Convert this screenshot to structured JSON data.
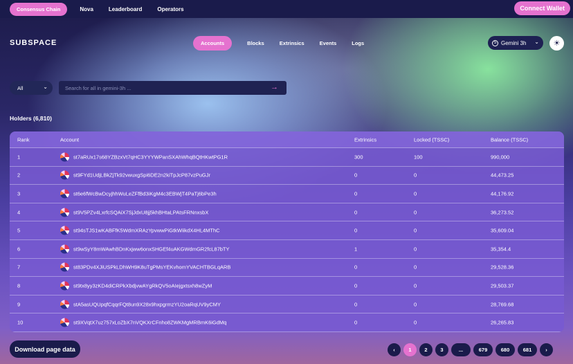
{
  "topbar": {
    "chain_label": "Consensus Chain",
    "links": [
      "Nova",
      "Leaderboard",
      "Operators"
    ],
    "connect_label": "Connect Wallet"
  },
  "logo": "SUBSPACE",
  "main_nav": {
    "tabs": [
      "Accounts",
      "Blocks",
      "Extrinsics",
      "Events",
      "Logs"
    ],
    "active": "Accounts"
  },
  "network": {
    "label": "Gemini 3h"
  },
  "search": {
    "filter_value": "All",
    "placeholder": "Search for all in gemini-3h ..."
  },
  "holders_title": "Holders (6,810)",
  "table": {
    "headers": [
      "Rank",
      "Account",
      "Extrinsics",
      "Locked (TSSC)",
      "Balance (TSSC)"
    ],
    "rows": [
      {
        "rank": "1",
        "account": "st7aRUx17s68YZBzxVt7qHC3YYYWPanSXAhWhqBQtHKwtPG1R",
        "extrinsics": "300",
        "locked": "100",
        "balance": "990,000"
      },
      {
        "rank": "2",
        "account": "st9FYd1UdjLBkZjTk92vwuxgSpi6DE2n2kiTpJcP87vzPuGJr",
        "extrinsics": "0",
        "locked": "0",
        "balance": "44,473.25"
      },
      {
        "rank": "3",
        "account": "st6e6fWcBwDcyjhhWuLeZFfBd3iKgM4c3EBWjT4PaTj6bPe3h",
        "extrinsics": "0",
        "locked": "0",
        "balance": "44,176.92"
      },
      {
        "rank": "4",
        "account": "st9V5PZv4LxrfcSQAiX7SjJdxU8jj5khBHtaLPAtsFRNnxsbX",
        "extrinsics": "0",
        "locked": "0",
        "balance": "36,273.52"
      },
      {
        "rank": "5",
        "account": "st94sTJS1wKABFfK5WdmXRAzYpvwwPiGtkWiikdX4HL4MThC",
        "extrinsics": "0",
        "locked": "0",
        "balance": "35,609.04"
      },
      {
        "rank": "6",
        "account": "st9wSyY8mWAwhBDnKxjww6onxSHGEf4uAKGWdmGR2fcL87bTY",
        "extrinsics": "1",
        "locked": "0",
        "balance": "35,354.4"
      },
      {
        "rank": "7",
        "account": "st83PDv4XJiUSPkLDhWH9K8uTgPMsYEKvhomYVACHTBGLqARB",
        "extrinsics": "0",
        "locked": "0",
        "balance": "29,528.36"
      },
      {
        "rank": "8",
        "account": "st9tx8yy3zKD4diCRPkXbdjvwAYgRkQV5oAIejgxtsxh8wZyM",
        "extrinsics": "0",
        "locked": "0",
        "balance": "29,503.37"
      },
      {
        "rank": "9",
        "account": "stA5asUQUpqfCqqrFQt8un9X28x9hxpgrmzYU2oaRqUV9yCMY",
        "extrinsics": "0",
        "locked": "0",
        "balance": "28,769.68"
      },
      {
        "rank": "10",
        "account": "st9XVqtX7uz757xLoZbX7nVQKXrCFnho8ZWKMgMRBmK6iGdMq",
        "extrinsics": "0",
        "locked": "0",
        "balance": "26,265.83"
      }
    ]
  },
  "download_label": "Download page data",
  "pagination": {
    "prev": "‹",
    "next": "›",
    "pages": [
      "1",
      "2",
      "3",
      "...",
      "679",
      "680",
      "681"
    ],
    "active": "1"
  },
  "colors": {
    "accent": "#e572cf",
    "dark": "#1a1b4b"
  }
}
